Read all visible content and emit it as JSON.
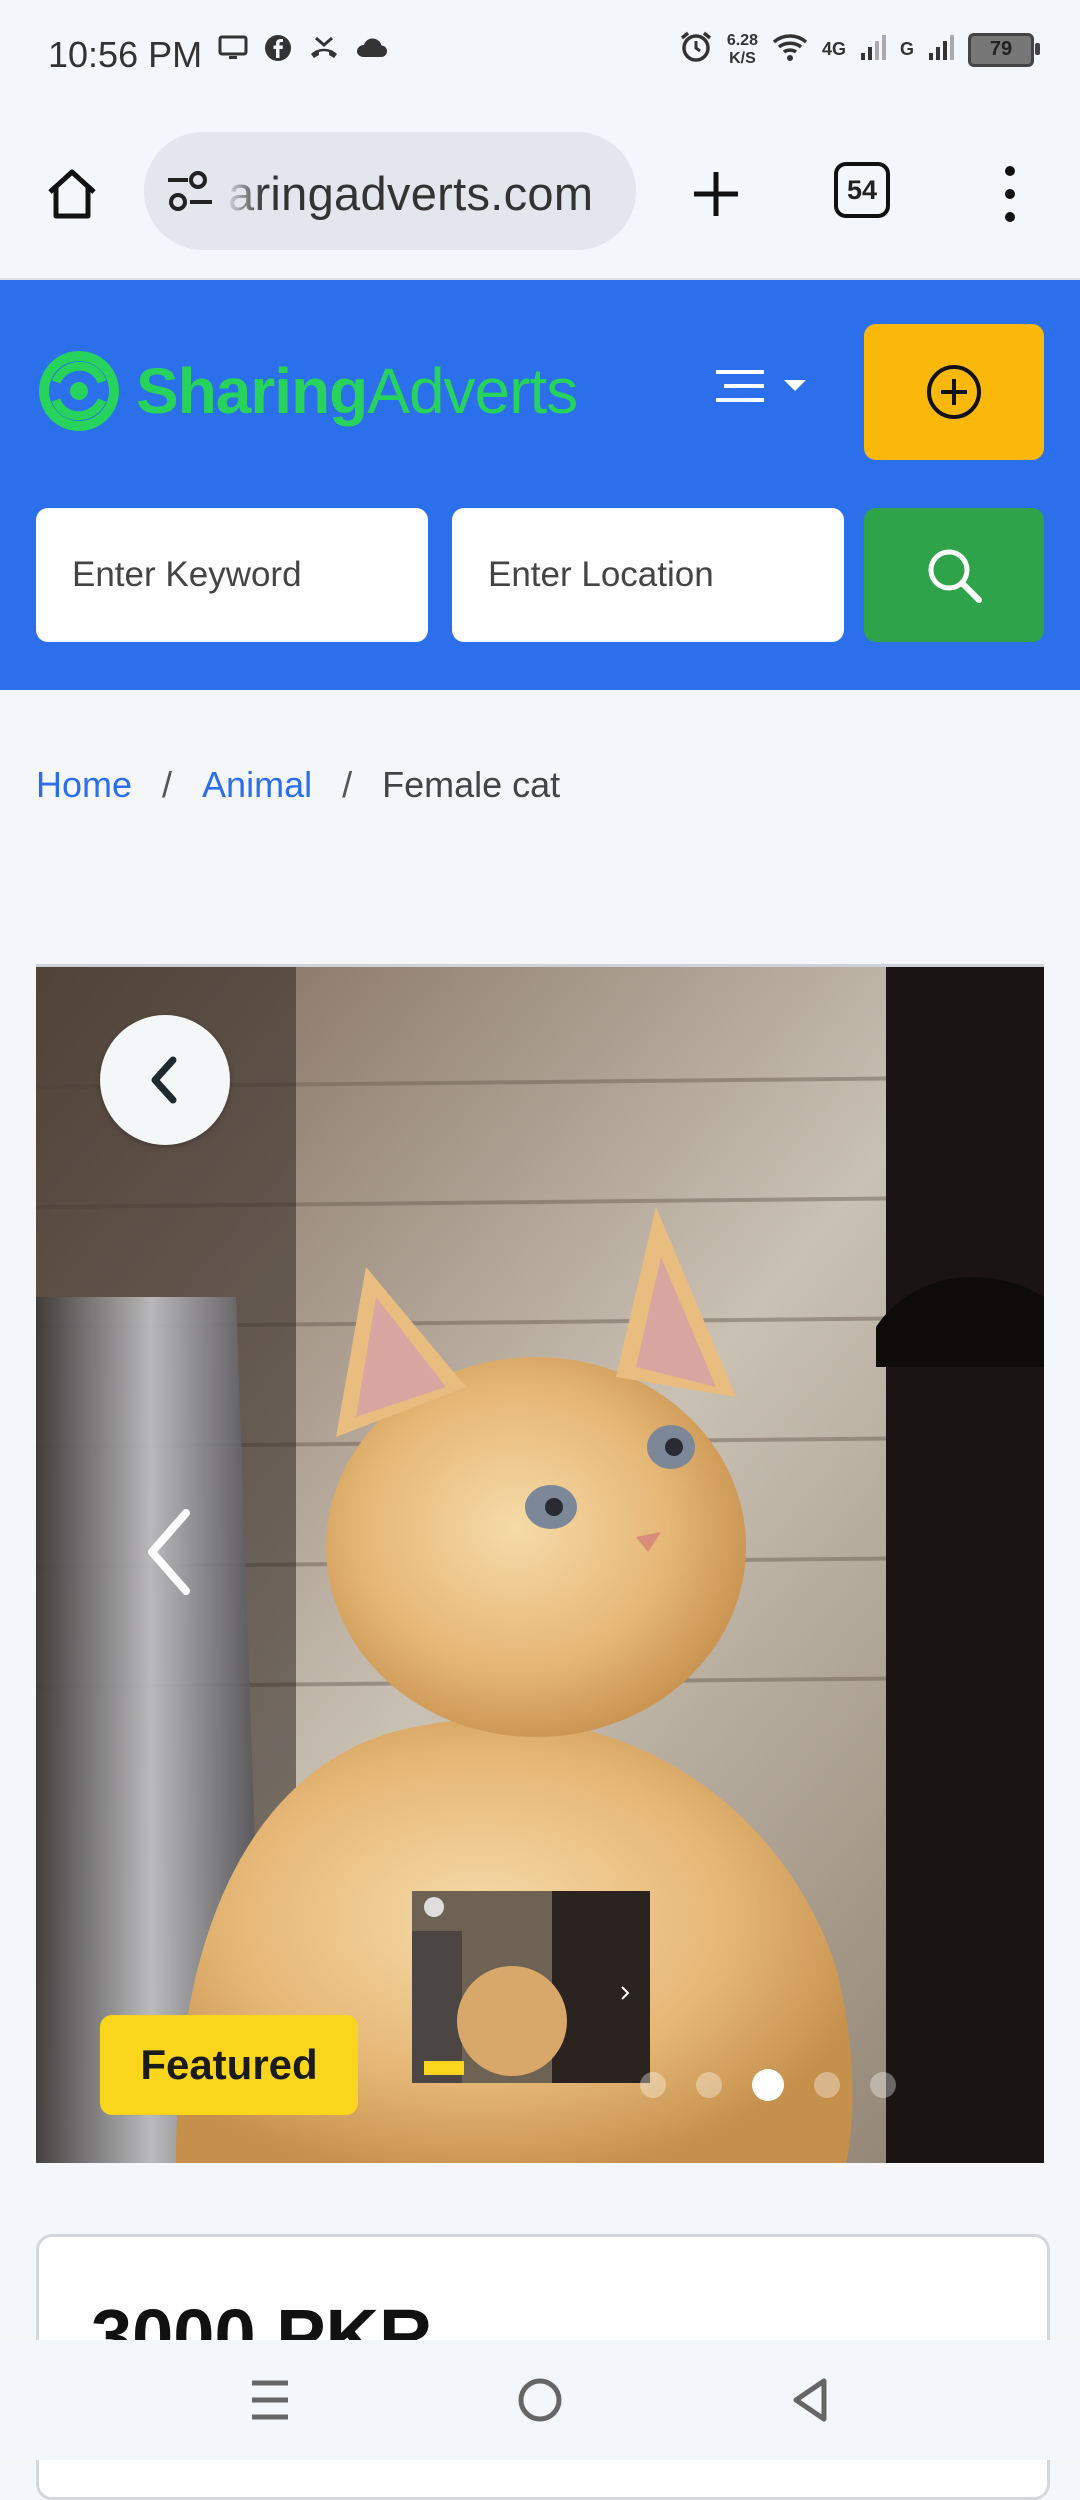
{
  "status_bar": {
    "time": "10:56 PM",
    "speed_top": "6.28",
    "speed_unit": "K/S",
    "net_4g": "4G",
    "net_g": "G",
    "battery": "79",
    "icons": [
      "screen-icon",
      "facebook-icon",
      "missed-call-icon",
      "cloud-icon",
      "alarm-icon",
      "wifi-icon",
      "signal-icon"
    ]
  },
  "browser": {
    "url": "aringadverts.com",
    "tab_count": "54",
    "icons": [
      "home-icon",
      "site-settings-icon",
      "plus-icon",
      "more-vert-icon"
    ]
  },
  "header": {
    "logo_bold": "Sharing",
    "logo_light": "Adverts",
    "brand_color": "#2b6fea",
    "logo_color": "#27d35c",
    "post_button_color": "#f9b80a",
    "search_button_color": "#2fa34a",
    "keyword_placeholder": "Enter Keyword",
    "location_placeholder": "Enter Location"
  },
  "breadcrumb": {
    "home": "Home",
    "sep1": "/",
    "category": "Animal",
    "sep2": "/",
    "current": "Female cat"
  },
  "gallery": {
    "badge": "Featured",
    "dots_total": 5,
    "active_dot": 3
  },
  "listing": {
    "price": "3000 PKR"
  },
  "nav_bar": {
    "icons": [
      "recent-apps-icon",
      "home-circle-icon",
      "back-triangle-icon"
    ]
  }
}
